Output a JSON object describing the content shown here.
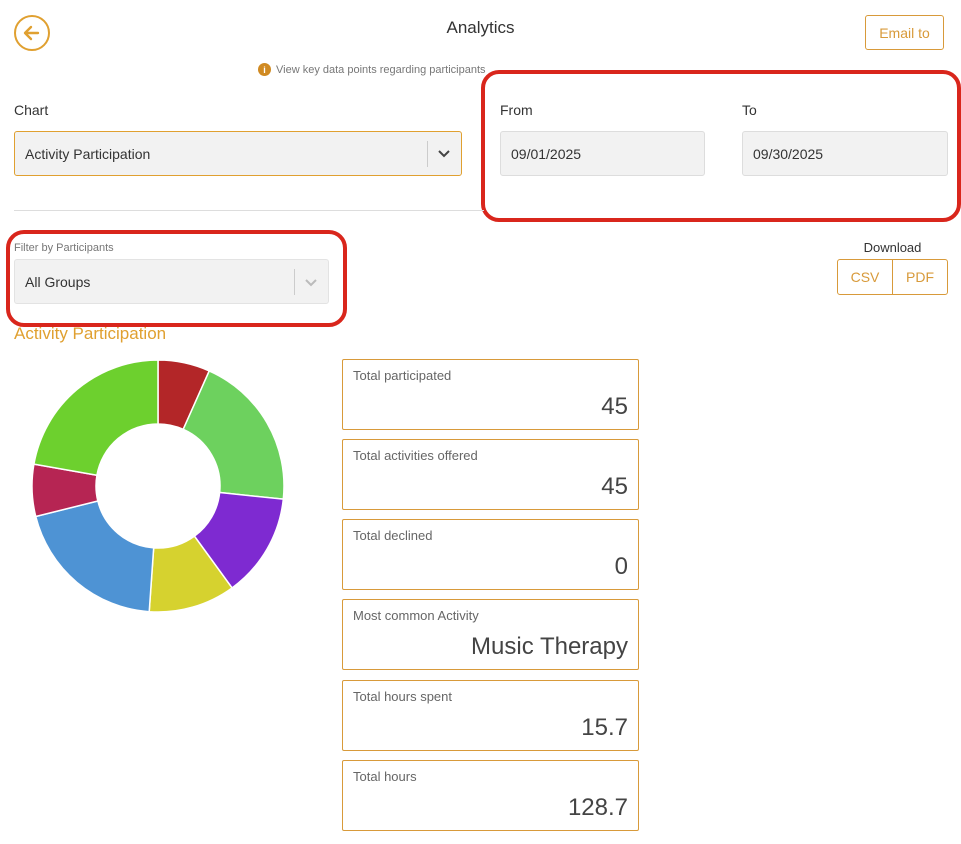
{
  "header": {
    "title": "Analytics",
    "email_label": "Email to",
    "info_text": "View key data points regarding participants"
  },
  "chart_select": {
    "label": "Chart",
    "value": "Activity Participation"
  },
  "dates": {
    "from_label": "From",
    "from_value": "09/01/2025",
    "to_label": "To",
    "to_value": "09/30/2025"
  },
  "filter": {
    "label": "Filter by Participants",
    "value": "All Groups"
  },
  "download": {
    "label": "Download",
    "csv": "CSV",
    "pdf": "PDF"
  },
  "section_title": "Activity Participation",
  "stats": [
    {
      "label": "Total participated",
      "value": "45"
    },
    {
      "label": "Total activities offered",
      "value": "45"
    },
    {
      "label": "Total declined",
      "value": "0"
    },
    {
      "label": "Most common Activity",
      "value": "Music Therapy"
    },
    {
      "label": "Total hours spent",
      "value": "15.7"
    },
    {
      "label": "Total hours",
      "value": "128.7"
    }
  ],
  "chart_data": {
    "type": "pie",
    "donut": true,
    "values": [
      3,
      9,
      6,
      5,
      9,
      3,
      10
    ],
    "colors": [
      "#b32628",
      "#6dd15e",
      "#7e2ad1",
      "#d6d22f",
      "#4e93d4",
      "#b62553",
      "#6dd02e"
    ]
  }
}
